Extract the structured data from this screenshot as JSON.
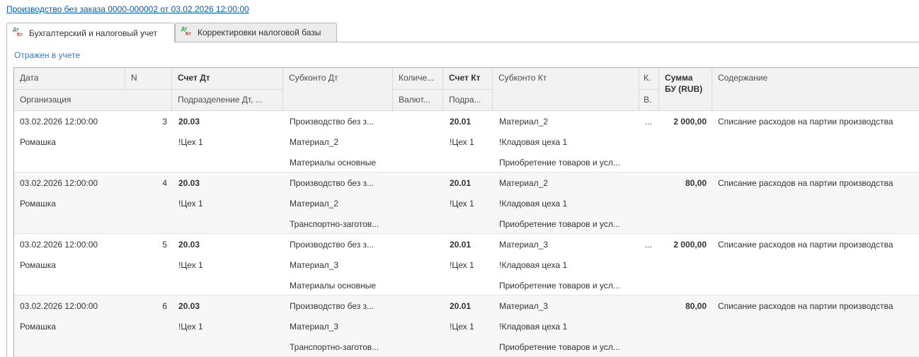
{
  "document": {
    "title": "Производство без заказа 0000-000002 от 03.02.2026 12:00:00"
  },
  "tabs": [
    {
      "label": "Бухгалтерский и налоговый учет",
      "icon": "dt-kt-icon",
      "active": true
    },
    {
      "label": "Корректировки налоговой базы",
      "icon": "dt-kt-icon",
      "active": false
    }
  ],
  "icon_text": {
    "dt": "Дт",
    "kt": "Кт"
  },
  "status": "Отражен в учете",
  "columns": {
    "date": "Дата",
    "n": "N",
    "account_dt": "Счет Дт",
    "subconto_dt": "Субконто Дт",
    "quantity": "Количе...",
    "account_kt": "Счет Кт",
    "subconto_kt": "Субконто Кт",
    "k": "К.",
    "sum": "Сумма БУ (RUB)",
    "content": "Содержание",
    "organization": "Организация",
    "division_dt": "Подразделение Дт, ...",
    "currency": "Валют...",
    "division_kt": "Подра...",
    "v": "В."
  },
  "rows": [
    {
      "date": "03.02.2026 12:00:00",
      "n": "3",
      "account_dt": "20.03",
      "subconto_dt": [
        "Производство без з...",
        "Материал_2",
        "Материалы основные"
      ],
      "account_kt": "20.01",
      "subconto_kt": [
        "Материал_2",
        "!Кладовая цеха 1",
        "Приобретение товаров и усл..."
      ],
      "k": "...",
      "sum": "2 000,00",
      "content": "Списание расходов на партии производства",
      "organization": "Ромашка",
      "division_dt": "!Цех 1",
      "division_kt": "!Цех 1"
    },
    {
      "date": "03.02.2026 12:00:00",
      "n": "4",
      "account_dt": "20.03",
      "subconto_dt": [
        "Производство без з...",
        "Материал_2",
        "Транспортно-заготов..."
      ],
      "account_kt": "20.01",
      "subconto_kt": [
        "Материал_2",
        "!Кладовая цеха 1",
        "Приобретение товаров и усл..."
      ],
      "k": "",
      "sum": "80,00",
      "content": "Списание расходов на партии производства",
      "organization": "Ромашка",
      "division_dt": "!Цех 1",
      "division_kt": "!Цех 1"
    },
    {
      "date": "03.02.2026 12:00:00",
      "n": "5",
      "account_dt": "20.03",
      "subconto_dt": [
        "Производство без з...",
        "Материал_3",
        "Материалы основные"
      ],
      "account_kt": "20.01",
      "subconto_kt": [
        "Материал_3",
        "!Кладовая цеха 1",
        "Приобретение товаров и усл..."
      ],
      "k": "...",
      "sum": "2 000,00",
      "content": "Списание расходов на партии производства",
      "organization": "Ромашка",
      "division_dt": "!Цех 1",
      "division_kt": "!Цех 1"
    },
    {
      "date": "03.02.2026 12:00:00",
      "n": "6",
      "account_dt": "20.03",
      "subconto_dt": [
        "Производство без з...",
        "Материал_3",
        "Транспортно-заготов..."
      ],
      "account_kt": "20.01",
      "subconto_kt": [
        "Материал_3",
        "!Кладовая цеха 1",
        "Приобретение товаров и усл..."
      ],
      "k": "",
      "sum": "80,00",
      "content": "Списание расходов на партии производства",
      "organization": "Ромашка",
      "division_dt": "!Цех 1",
      "division_kt": "!Цех 1"
    }
  ]
}
